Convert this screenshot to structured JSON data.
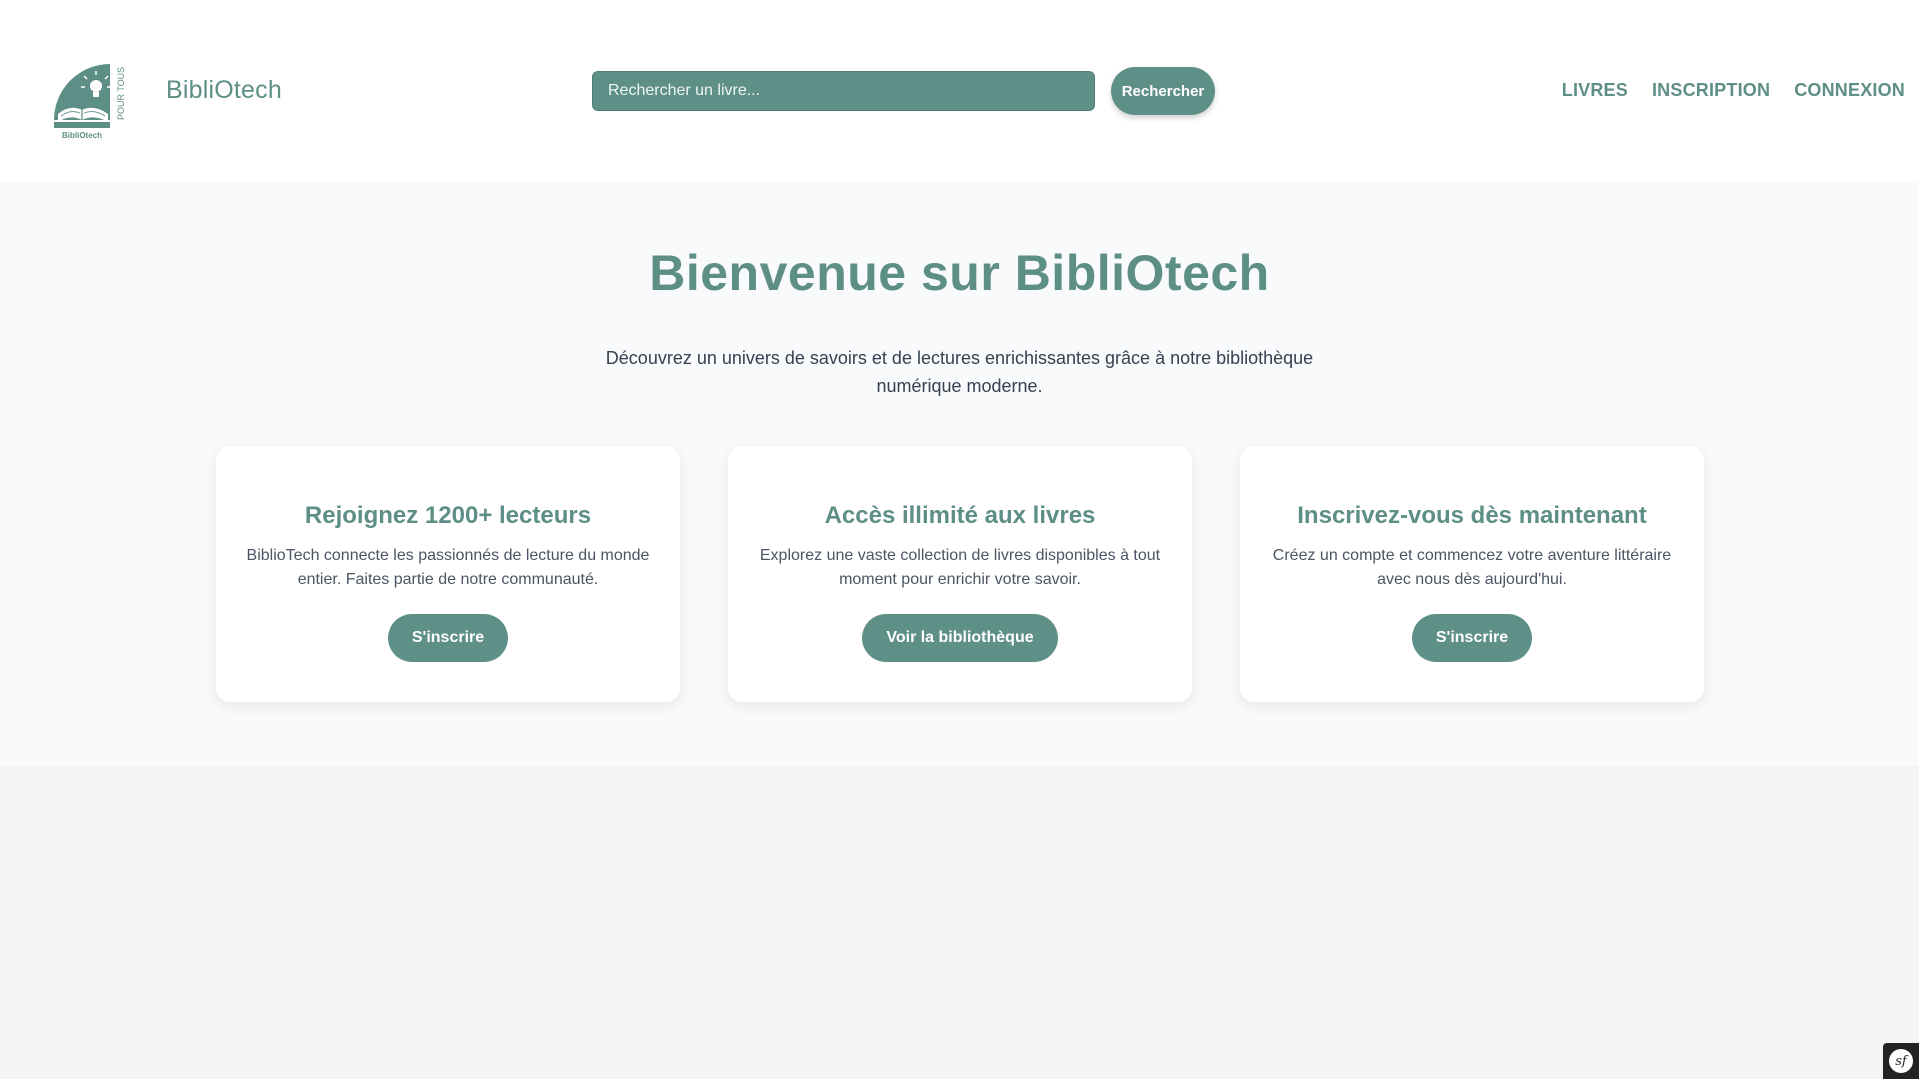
{
  "header": {
    "brand": "BibliOtech",
    "logo": {
      "caption": "BibliOtech",
      "side_text": "POUR TOUS",
      "icon": "open-book-lightbulb-icon",
      "color": "#5e8f86"
    },
    "search": {
      "placeholder": "Rechercher un livre...",
      "value": "",
      "button_label": "Rechercher"
    },
    "nav": [
      {
        "label": "LIVRES"
      },
      {
        "label": "INSCRIPTION"
      },
      {
        "label": "CONNEXION"
      }
    ]
  },
  "hero": {
    "title": "Bienvenue sur BibliOtech",
    "subtitle": "Découvrez un univers de savoirs et de lectures enrichissantes grâce à notre bibliothèque numérique moderne."
  },
  "cards": [
    {
      "title": "Rejoignez 1200+ lecteurs",
      "text": "BiblioTech connecte les passionnés de lecture du monde entier. Faites partie de notre communauté.",
      "button": "S'inscrire"
    },
    {
      "title": "Accès illimité aux livres",
      "text": "Explorez une vaste collection de livres disponibles à tout moment pour enrichir votre savoir.",
      "button": "Voir la bibliothèque"
    },
    {
      "title": "Inscrivez-vous dès maintenant",
      "text": "Créez un compte et commencez votre aventure littéraire avec nous dès aujourd'hui.",
      "button": "S'inscrire"
    }
  ],
  "toolbar": {
    "icon": "symfony-icon",
    "glyph": "sf"
  },
  "colors": {
    "accent": "#5f9087",
    "accent_text": "#5e8f86",
    "hero_bg": "#f8fafb",
    "page_bg": "#f3f4f6"
  }
}
